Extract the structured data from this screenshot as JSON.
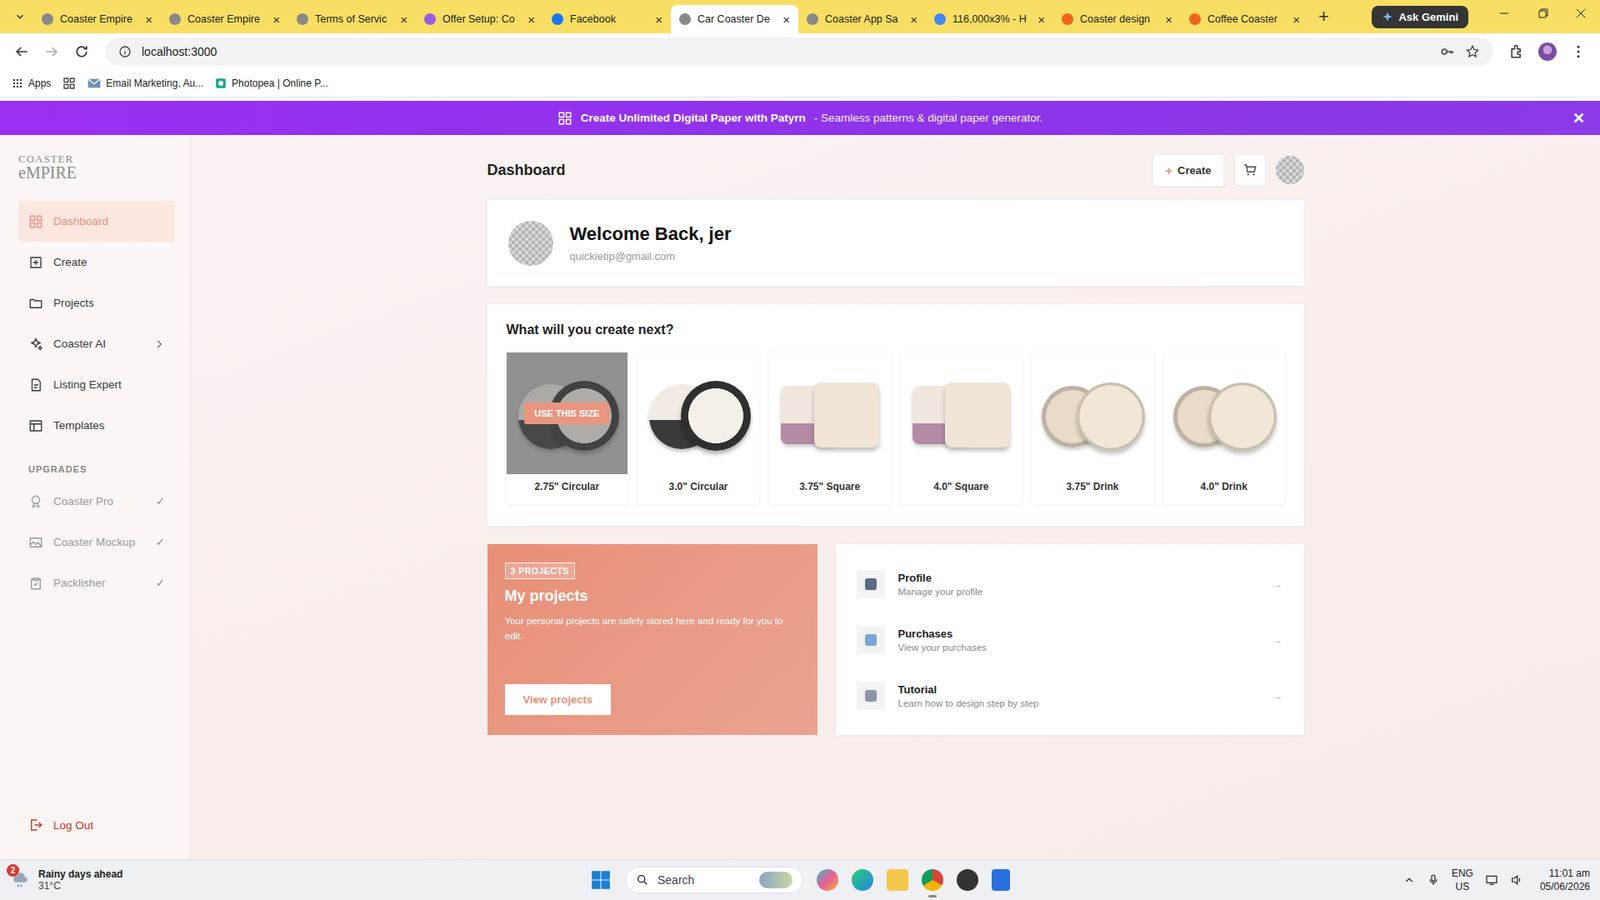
{
  "browser": {
    "tabs": [
      {
        "label": "Coaster Empire",
        "selected": false
      },
      {
        "label": "Coaster Empire",
        "selected": false
      },
      {
        "label": "Terms of Servic",
        "selected": false
      },
      {
        "label": "Offer Setup: Co",
        "selected": false
      },
      {
        "label": "Facebook",
        "selected": false
      },
      {
        "label": "Car Coaster De",
        "selected": true
      },
      {
        "label": "Coaster App Sa",
        "selected": false
      },
      {
        "label": "116,000x3% - H",
        "selected": false
      },
      {
        "label": "Coaster design",
        "selected": false
      },
      {
        "label": "Coffee Coaster",
        "selected": false
      }
    ],
    "tab_close": "×",
    "new_tab": "+",
    "gemini": "Ask Gemini",
    "address": "localhost:3000",
    "bookmarks": [
      "Apps",
      "Email Marketing, Au...",
      "Photopea | Online P..."
    ]
  },
  "banner": {
    "title": "Create Unlimited Digital Paper with Patyrn",
    "subtitle": "- Seamless patterns & digital paper generator.",
    "close": "✕"
  },
  "logo": {
    "line1": "COASTER",
    "line2": "eMPIRE"
  },
  "sidebar": {
    "items": [
      {
        "label": "Dashboard",
        "selected": true,
        "submenu": false
      },
      {
        "label": "Create",
        "selected": false,
        "submenu": false
      },
      {
        "label": "Projects",
        "selected": false,
        "submenu": false
      },
      {
        "label": "Coaster AI",
        "selected": false,
        "submenu": true
      },
      {
        "label": "Listing Expert",
        "selected": false,
        "submenu": false
      },
      {
        "label": "Templates",
        "selected": false,
        "submenu": false
      }
    ],
    "section": "UPGRADES",
    "check_glyph": "✓",
    "upgrades": [
      {
        "label": "Coaster Pro",
        "checked": true
      },
      {
        "label": "Coaster Mockup",
        "checked": true
      },
      {
        "label": "Packlisher",
        "checked": true
      }
    ],
    "logout": "Log Out"
  },
  "header": {
    "title": "Dashboard",
    "create_icon": "+",
    "create": "Create"
  },
  "welcome": {
    "title": "Welcome Back, jer",
    "email": "quickietip@gmail.com"
  },
  "create_next": {
    "title": "What will you create next?",
    "hover_action": "USE THIS SIZE",
    "sizes": [
      {
        "label": "2.75\" Circular",
        "kind": "circle",
        "hovered": true
      },
      {
        "label": "3.0\" Circular",
        "kind": "circle",
        "hovered": false
      },
      {
        "label": "3.75\" Square",
        "kind": "square",
        "hovered": false
      },
      {
        "label": "4.0\" Square",
        "kind": "square",
        "hovered": false
      },
      {
        "label": "3.75\" Drink",
        "kind": "drink",
        "hovered": false
      },
      {
        "label": "4.0\" Drink",
        "kind": "drink",
        "hovered": false
      }
    ]
  },
  "projects": {
    "badge": "3 PROJECTS",
    "title": "My projects",
    "text": "Your personal projects are safely stored here and ready for you to edit.",
    "button": "View projects"
  },
  "links": {
    "arrow": "→",
    "items": [
      {
        "title": "Profile",
        "subtitle": "Manage your profile"
      },
      {
        "title": "Purchases",
        "subtitle": "View your purchases"
      },
      {
        "title": "Tutorial",
        "subtitle": "Learn how to design step by step"
      }
    ]
  },
  "taskbar": {
    "weather": "Rainy days ahead",
    "temp": "31°C",
    "badge": "2",
    "search": "Search",
    "lang": "ENG",
    "region": "US",
    "time": "11:01 am",
    "date": "05/06/2026"
  }
}
